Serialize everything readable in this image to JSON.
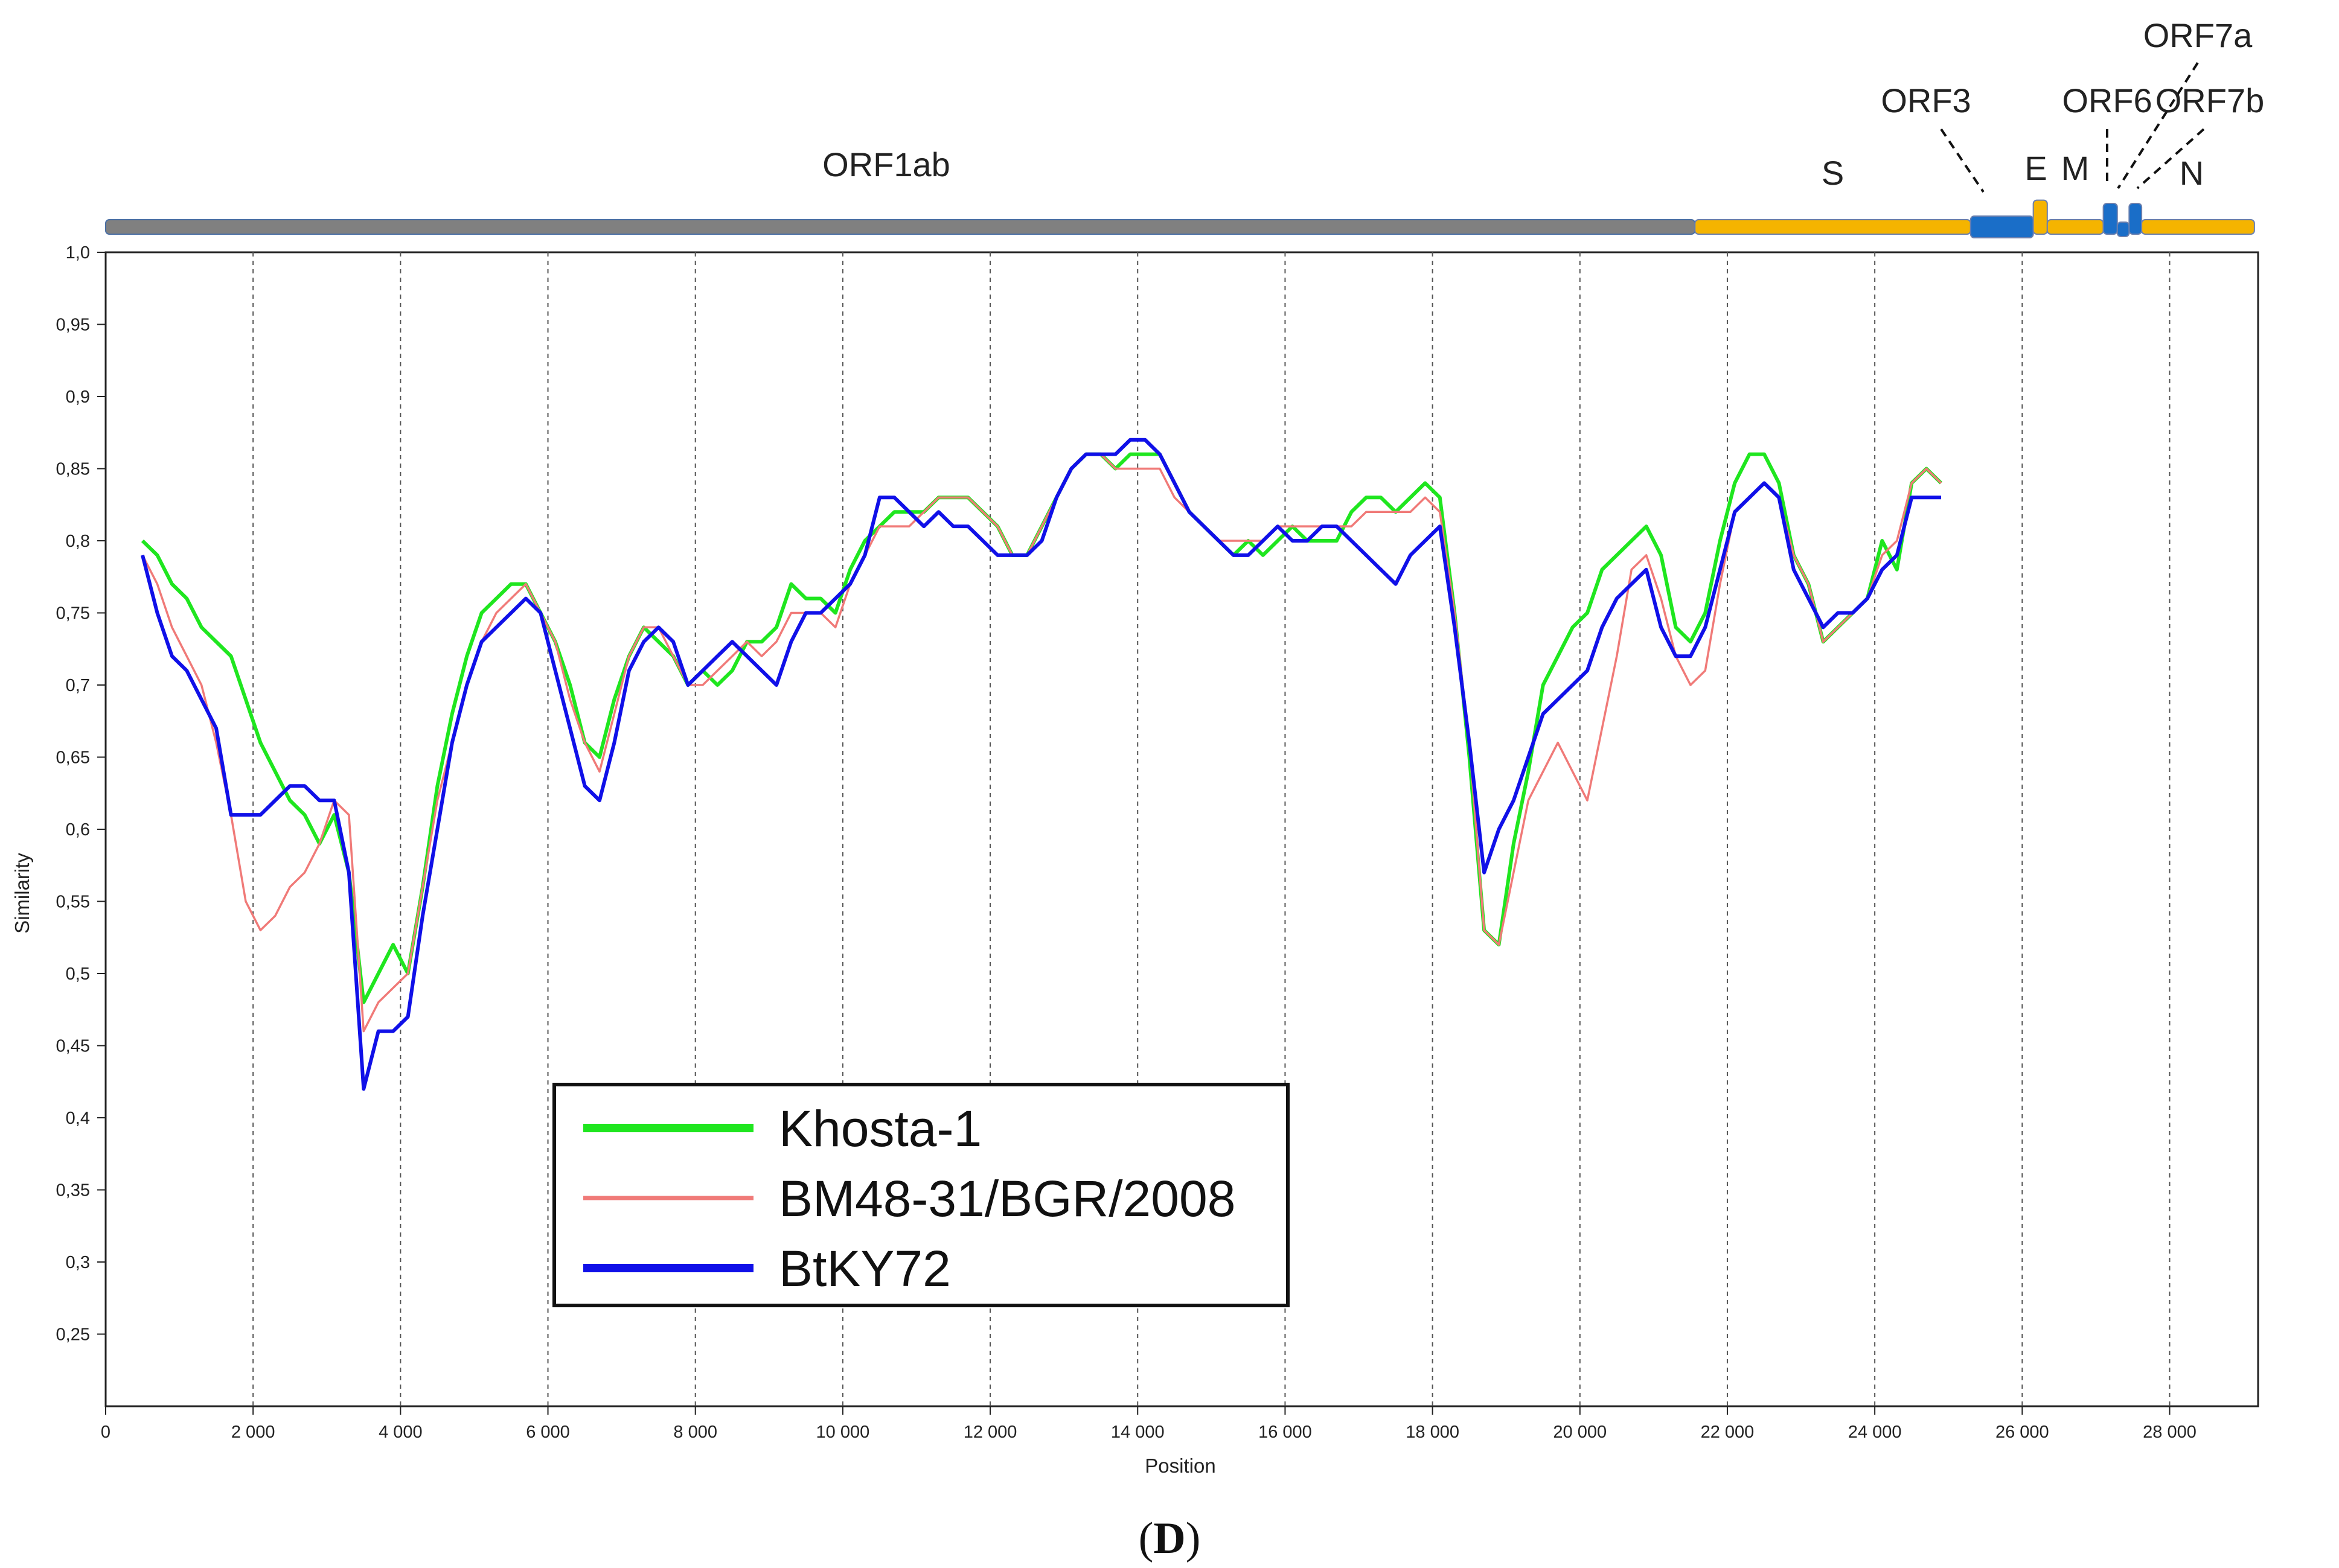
{
  "chart_data": {
    "type": "line",
    "xlabel": "Position",
    "ylabel": "Similarity",
    "xlim": [
      0,
      29200
    ],
    "ylim": [
      0.2,
      1.0
    ],
    "x_ticks": [
      {
        "value": 0,
        "label": "0"
      },
      {
        "value": 2000,
        "label": "2 000"
      },
      {
        "value": 4000,
        "label": "4 000"
      },
      {
        "value": 6000,
        "label": "6 000"
      },
      {
        "value": 8000,
        "label": "8 000"
      },
      {
        "value": 10000,
        "label": "10 000"
      },
      {
        "value": 12000,
        "label": "12 000"
      },
      {
        "value": 14000,
        "label": "14 000"
      },
      {
        "value": 16000,
        "label": "16 000"
      },
      {
        "value": 18000,
        "label": "18 000"
      },
      {
        "value": 20000,
        "label": "20 000"
      },
      {
        "value": 22000,
        "label": "22 000"
      },
      {
        "value": 24000,
        "label": "24 000"
      },
      {
        "value": 26000,
        "label": "26 000"
      },
      {
        "value": 28000,
        "label": "28 000"
      }
    ],
    "y_ticks": [
      {
        "value": 1.0,
        "label": "1,0"
      },
      {
        "value": 0.95,
        "label": "0,95"
      },
      {
        "value": 0.9,
        "label": "0,9"
      },
      {
        "value": 0.85,
        "label": "0,85"
      },
      {
        "value": 0.8,
        "label": "0,8"
      },
      {
        "value": 0.75,
        "label": "0,75"
      },
      {
        "value": 0.7,
        "label": "0,7"
      },
      {
        "value": 0.65,
        "label": "0,65"
      },
      {
        "value": 0.6,
        "label": "0,6"
      },
      {
        "value": 0.55,
        "label": "0,55"
      },
      {
        "value": 0.5,
        "label": "0,5"
      },
      {
        "value": 0.45,
        "label": "0,45"
      },
      {
        "value": 0.4,
        "label": "0,4"
      },
      {
        "value": 0.35,
        "label": "0,35"
      },
      {
        "value": 0.3,
        "label": "0,3"
      },
      {
        "value": 0.25,
        "label": "0,25"
      }
    ],
    "grid": "vertical dashed lines at x ticks",
    "legend": {
      "placement": "lower-left"
    },
    "x": [
      500,
      700,
      900,
      1100,
      1300,
      1500,
      1700,
      1900,
      2100,
      2300,
      2500,
      2700,
      2900,
      3100,
      3300,
      3500,
      3700,
      3900,
      4100,
      4300,
      4500,
      4700,
      4900,
      5100,
      5300,
      5500,
      5700,
      5900,
      6100,
      6300,
      6500,
      6700,
      6900,
      7100,
      7300,
      7500,
      7700,
      7900,
      8100,
      8300,
      8500,
      8700,
      8900,
      9100,
      9300,
      9500,
      9700,
      9900,
      10100,
      10300,
      10500,
      10700,
      10900,
      11100,
      11300,
      11500,
      11700,
      11900,
      12100,
      12300,
      12500,
      12700,
      12900,
      13100,
      13300,
      13500,
      13700,
      13900,
      14100,
      14300,
      14500,
      14700,
      14900,
      15100,
      15300,
      15500,
      15700,
      15900,
      16100,
      16300,
      16500,
      16700,
      16900,
      17100,
      17300,
      17500,
      17700,
      17900,
      18100,
      18300,
      18500,
      18700,
      18900,
      19100,
      19300,
      19500,
      19700,
      19900,
      20100,
      20300,
      20500,
      20700,
      20900,
      21100,
      21300,
      21500,
      21700,
      21900,
      22100,
      22300,
      22500,
      22700,
      22900,
      23100,
      23300,
      23500,
      23700,
      23900,
      24100,
      24300,
      24500,
      24700,
      24900,
      25100,
      25300,
      25500,
      25700,
      25900,
      26100,
      26300,
      26500,
      26700,
      26900,
      27100,
      27300,
      27500,
      27700,
      27900,
      28100,
      28300,
      28500
    ],
    "series": [
      {
        "name": "Khosta-1",
        "color": "#1fe61f",
        "width": "thick",
        "values": [
          0.8,
          0.79,
          0.77,
          0.76,
          0.74,
          0.73,
          0.72,
          0.69,
          0.66,
          0.64,
          0.62,
          0.61,
          0.59,
          0.61,
          0.57,
          0.48,
          0.5,
          0.52,
          0.5,
          0.56,
          0.63,
          0.68,
          0.72,
          0.75,
          0.76,
          0.77,
          0.77,
          0.75,
          0.73,
          0.7,
          0.66,
          0.65,
          0.69,
          0.72,
          0.74,
          0.73,
          0.72,
          0.7,
          0.71,
          0.7,
          0.71,
          0.73,
          0.73,
          0.74,
          0.77,
          0.76,
          0.76,
          0.75,
          0.78,
          0.8,
          0.81,
          0.82,
          0.82,
          0.82,
          0.83,
          0.83,
          0.83,
          0.82,
          0.81,
          0.79,
          0.79,
          0.81,
          0.83,
          0.85,
          0.86,
          0.86,
          0.85,
          0.86,
          0.86,
          0.86,
          0.84,
          0.82,
          0.81,
          0.8,
          0.79,
          0.8,
          0.79,
          0.8,
          0.81,
          0.8,
          0.8,
          0.8,
          0.82,
          0.83,
          0.83,
          0.82,
          0.83,
          0.84,
          0.83,
          0.75,
          0.65,
          0.53,
          0.52,
          0.59,
          0.64,
          0.7,
          0.72,
          0.74,
          0.75,
          0.78,
          0.79,
          0.8,
          0.81,
          0.79,
          0.74,
          0.73,
          0.75,
          0.8,
          0.84,
          0.86,
          0.86,
          0.84,
          0.79,
          0.77,
          0.73,
          0.74,
          0.75,
          0.76,
          0.8,
          0.78,
          0.84,
          0.85,
          0.84
        ],
        "note_x_start": 500
      },
      {
        "name": "BM48-31/BGR/2008",
        "color": "#f07a78",
        "width": "thin",
        "values": [
          0.79,
          0.77,
          0.74,
          0.72,
          0.7,
          0.66,
          0.61,
          0.55,
          0.53,
          0.54,
          0.56,
          0.57,
          0.59,
          0.62,
          0.61,
          0.46,
          0.48,
          0.49,
          0.5,
          0.56,
          0.62,
          0.66,
          0.7,
          0.73,
          0.75,
          0.76,
          0.77,
          0.75,
          0.73,
          0.69,
          0.66,
          0.64,
          0.68,
          0.72,
          0.74,
          0.74,
          0.72,
          0.7,
          0.7,
          0.71,
          0.72,
          0.73,
          0.72,
          0.73,
          0.75,
          0.75,
          0.75,
          0.74,
          0.77,
          0.79,
          0.81,
          0.81,
          0.81,
          0.82,
          0.83,
          0.83,
          0.83,
          0.82,
          0.81,
          0.79,
          0.79,
          0.81,
          0.83,
          0.85,
          0.86,
          0.86,
          0.85,
          0.85,
          0.85,
          0.85,
          0.83,
          0.82,
          0.81,
          0.8,
          0.8,
          0.8,
          0.8,
          0.81,
          0.81,
          0.81,
          0.81,
          0.81,
          0.81,
          0.82,
          0.82,
          0.82,
          0.82,
          0.83,
          0.82,
          0.75,
          0.66,
          0.53,
          0.52,
          0.57,
          0.62,
          0.64,
          0.66,
          0.64,
          0.62,
          0.67,
          0.72,
          0.78,
          0.79,
          0.76,
          0.72,
          0.7,
          0.71,
          0.77,
          0.82,
          0.83,
          0.84,
          0.83,
          0.79,
          0.77,
          0.73,
          0.74,
          0.75,
          0.76,
          0.79,
          0.8,
          0.84,
          0.85,
          0.84
        ]
      },
      {
        "name": "BtKY72",
        "color": "#1010e8",
        "width": "thick",
        "values": [
          0.79,
          0.75,
          0.72,
          0.71,
          0.69,
          0.67,
          0.61,
          0.61,
          0.61,
          0.62,
          0.63,
          0.63,
          0.62,
          0.62,
          0.57,
          0.42,
          0.46,
          0.46,
          0.47,
          0.54,
          0.6,
          0.66,
          0.7,
          0.73,
          0.74,
          0.75,
          0.76,
          0.75,
          0.71,
          0.67,
          0.63,
          0.62,
          0.66,
          0.71,
          0.73,
          0.74,
          0.73,
          0.7,
          0.71,
          0.72,
          0.73,
          0.72,
          0.71,
          0.7,
          0.73,
          0.75,
          0.75,
          0.76,
          0.77,
          0.79,
          0.83,
          0.83,
          0.82,
          0.81,
          0.82,
          0.81,
          0.81,
          0.8,
          0.79,
          0.79,
          0.79,
          0.8,
          0.83,
          0.85,
          0.86,
          0.86,
          0.86,
          0.87,
          0.87,
          0.86,
          0.84,
          0.82,
          0.81,
          0.8,
          0.79,
          0.79,
          0.8,
          0.81,
          0.8,
          0.8,
          0.81,
          0.81,
          0.8,
          0.79,
          0.78,
          0.77,
          0.79,
          0.8,
          0.81,
          0.74,
          0.66,
          0.57,
          0.6,
          0.62,
          0.65,
          0.68,
          0.69,
          0.7,
          0.71,
          0.74,
          0.76,
          0.77,
          0.78,
          0.74,
          0.72,
          0.72,
          0.74,
          0.78,
          0.82,
          0.83,
          0.84,
          0.83,
          0.78,
          0.76,
          0.74,
          0.75,
          0.75,
          0.76,
          0.78,
          0.79,
          0.83,
          0.83,
          0.83
        ]
      }
    ],
    "genome_annotation": [
      {
        "label": "ORF1ab",
        "start": 0,
        "end": 21560,
        "color": "#808080"
      },
      {
        "label": "S",
        "start": 21560,
        "end": 25300,
        "color": "#f5b400"
      },
      {
        "label": "ORF3",
        "start": 25300,
        "end": 26150,
        "color": "#1a6ec8"
      },
      {
        "label": "E",
        "start": 26150,
        "end": 26340,
        "color": "#f5b400"
      },
      {
        "label": "M",
        "start": 26340,
        "end": 27100,
        "color": "#f5b400"
      },
      {
        "label": "ORF6",
        "start": 27100,
        "end": 27290,
        "color": "#1a6ec8"
      },
      {
        "label": "ORF7a",
        "start": 27290,
        "end": 27450,
        "color": "#1a6ec8"
      },
      {
        "label": "ORF7b",
        "start": 27450,
        "end": 27620,
        "color": "#1a6ec8"
      },
      {
        "label": "N",
        "start": 27620,
        "end": 29150,
        "color": "#f5b400"
      }
    ]
  },
  "caption": {
    "open": "(",
    "letter": "D",
    "close": ")"
  }
}
